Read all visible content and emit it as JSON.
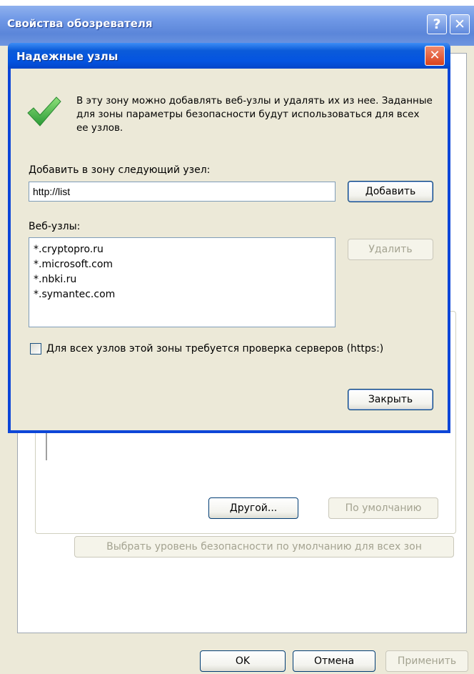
{
  "back_window": {
    "title": "Свойства обозревателя",
    "help_glyph": "?",
    "close_glyph": "✕",
    "custom_button": "Другой...",
    "default_button": "По умолчанию",
    "reset_all_button": "Выбрать уровень безопасности по умолчанию для всех зон",
    "ok_button": "OK",
    "cancel_button": "Отмена",
    "apply_button": "Применить"
  },
  "dialog": {
    "title": "Надежные узлы",
    "close_glyph": "✕",
    "intro_text": "В эту зону можно добавлять веб-узлы и удалять их из нее. Заданные для зоны параметры безопасности будут использоваться для всех ее узлов.",
    "add_label": "Добавить в зону следующий узел:",
    "url_value": "http://list",
    "add_button": "Добавить",
    "sites_label": "Веб-узлы:",
    "sites": [
      "*.cryptopro.ru",
      "*.microsoft.com",
      "*.nbki.ru",
      "*.symantec.com"
    ],
    "remove_button": "Удалить",
    "https_checkbox_label": "Для всех узлов этой зоны требуется проверка серверов (https:)",
    "https_required": false,
    "close_button": "Закрыть"
  },
  "icons": {
    "check": "green-checkmark-icon"
  },
  "colors": {
    "xp_title_blue": "#0454e1",
    "close_red": "#d9421d",
    "dialog_face": "#ece9d8",
    "check_green": "#3cb54a"
  }
}
